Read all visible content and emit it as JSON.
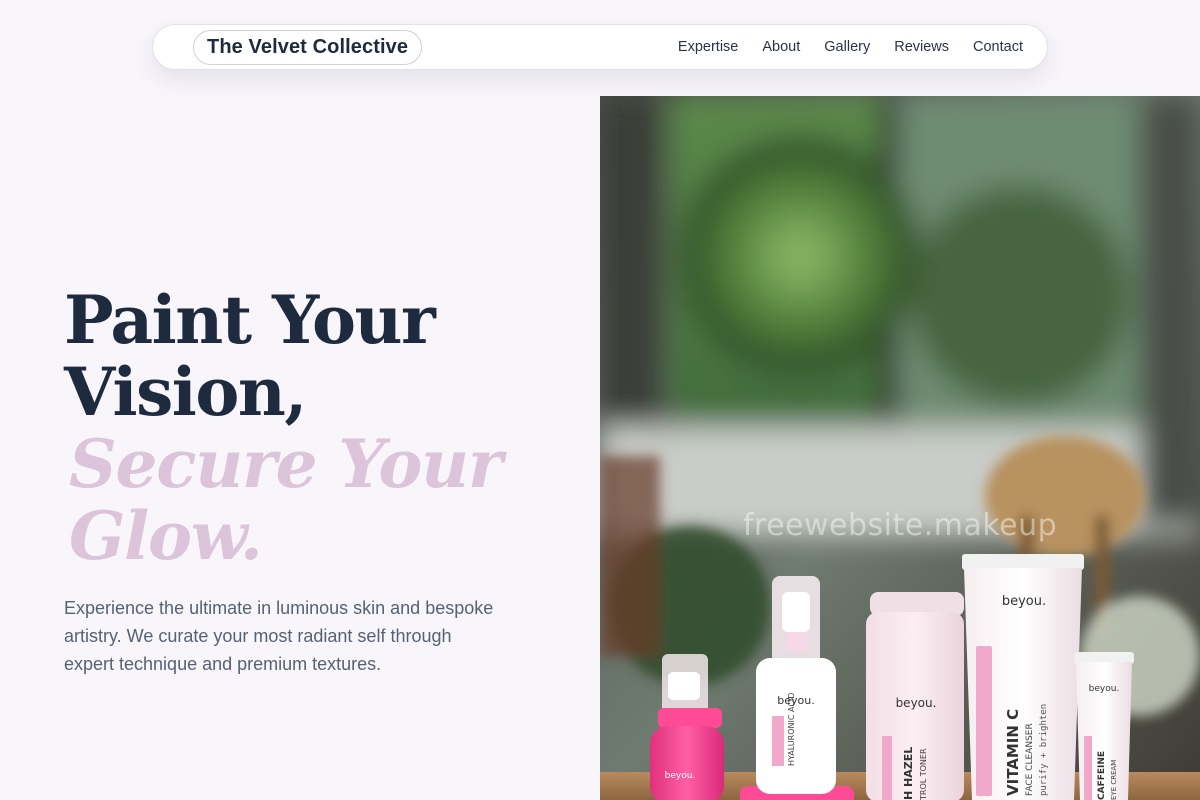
{
  "nav": {
    "brand": "The Velvet Collective",
    "links": [
      "Expertise",
      "About",
      "Gallery",
      "Reviews",
      "Contact"
    ]
  },
  "hero": {
    "title_line1": "Paint Your",
    "title_line2": "Vision,",
    "accent_line1": "Secure Your",
    "accent_line2": "Glow.",
    "description": "Experience the ultimate in luminous skin and bespoke artistry. We curate your most radiant self through expert technique and premium textures."
  },
  "image": {
    "watermark": "freewebsite.makeup",
    "brand_text": "beyou.",
    "product_labels": {
      "serum": "HYALURONIC ACID",
      "toner": "H HAZEL",
      "toner_sub": "TROL TONER",
      "cleanser": "VITAMIN C",
      "cleanser_sub": "FACE CLEANSER",
      "cleanser_tag": "purify + brighten",
      "eyecream": "CAFFEINE",
      "eyecream_sub": "EYE CREAM"
    }
  },
  "colors": {
    "heading": "#1e2a3e",
    "accent": "#dcc4da",
    "body_text": "#566274",
    "background": "#f8f6fb",
    "product_pink": "#f0509a"
  }
}
